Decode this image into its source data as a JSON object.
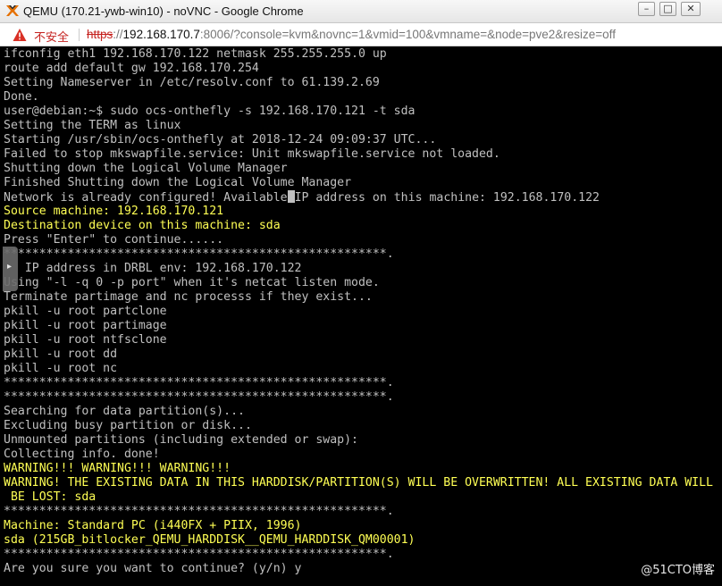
{
  "window": {
    "title": "QEMU (170.21-ywb-win10) - noVNC - Google Chrome",
    "controls": {
      "minimize": "–",
      "maximize": "□",
      "close": "✕"
    }
  },
  "address": {
    "security_label": "不安全",
    "url_protocol": "https",
    "url_sep": "://",
    "url_host": "192.168.170.7",
    "url_rest": ":8006/?console=kvm&novnc=1&vmid=100&vmname=&node=pve2&resize=off"
  },
  "terminal": {
    "lines": [
      {
        "text": "ifconfig eth1 192.168.170.122 netmask 255.255.255.0 up",
        "color": "grey"
      },
      {
        "text": "route add default gw 192.168.170.254",
        "color": "grey"
      },
      {
        "text": "Setting Nameserver in /etc/resolv.conf to 61.139.2.69",
        "color": "grey"
      },
      {
        "text": "Done.",
        "color": "grey"
      },
      {
        "text": "user@debian:~$ sudo ocs-onthefly -s 192.168.170.121 -t sda",
        "color": "grey"
      },
      {
        "text": "Setting the TERM as linux",
        "color": "grey"
      },
      {
        "text": "Starting /usr/sbin/ocs-onthefly at 2018-12-24 09:09:37 UTC...",
        "color": "grey"
      },
      {
        "text": "Failed to stop mkswapfile.service: Unit mkswapfile.service not loaded.",
        "color": "grey"
      },
      {
        "text": "Shutting down the Logical Volume Manager",
        "color": "grey"
      },
      {
        "text": "Finished Shutting down the Logical Volume Manager",
        "color": "grey"
      },
      {
        "text": "Network is already configured! Available IP address on this machine: 192.168.170.122",
        "color": "grey"
      },
      {
        "text": "Source machine: 192.168.170.121",
        "color": "yellow"
      },
      {
        "text": "Destination device on this machine: sda",
        "color": "yellow"
      },
      {
        "text": "Press \"Enter\" to continue......",
        "color": "grey"
      },
      {
        "text": "******************************************************.",
        "color": "grey"
      },
      {
        "text": "   IP address in DRBL env: 192.168.170.122",
        "color": "grey"
      },
      {
        "text": "Using \"-l -q 0 -p port\" when it's netcat listen mode.",
        "color": "grey"
      },
      {
        "text": "Terminate partimage and nc processs if they exist...",
        "color": "grey"
      },
      {
        "text": "pkill -u root partclone",
        "color": "grey"
      },
      {
        "text": "pkill -u root partimage",
        "color": "grey"
      },
      {
        "text": "pkill -u root ntfsclone",
        "color": "grey"
      },
      {
        "text": "pkill -u root dd",
        "color": "grey"
      },
      {
        "text": "pkill -u root nc",
        "color": "grey"
      },
      {
        "text": "******************************************************.",
        "color": "grey"
      },
      {
        "text": "******************************************************.",
        "color": "grey"
      },
      {
        "text": "Searching for data partition(s)...",
        "color": "grey"
      },
      {
        "text": "Excluding busy partition or disk...",
        "color": "grey"
      },
      {
        "text": "Unmounted partitions (including extended or swap):",
        "color": "grey"
      },
      {
        "text": "Collecting info. done!",
        "color": "grey"
      },
      {
        "text": "WARNING!!! WARNING!!! WARNING!!!",
        "color": "yellow"
      },
      {
        "text": "WARNING! THE EXISTING DATA IN THIS HARDDISK/PARTITION(S) WILL BE OVERWRITTEN! ALL EXISTING DATA WILL",
        "color": "yellow"
      },
      {
        "text": " BE LOST: sda",
        "color": "yellow"
      },
      {
        "text": "******************************************************.",
        "color": "grey"
      },
      {
        "text": "Machine: Standard PC (i440FX + PIIX, 1996)",
        "color": "yellow"
      },
      {
        "text": "sda (215GB_bitlocker_QEMU_HARDDISK__QEMU_HARDDISK_QM00001)",
        "color": "yellow"
      },
      {
        "text": "******************************************************.",
        "color": "grey"
      },
      {
        "text": "Are you sure you want to continue? (y/n) y",
        "color": "grey"
      }
    ],
    "cursor_line": 10,
    "cursor_after": "Network is already configured! Available",
    "cursor_rest": "IP address on this machine: 192.168.170.122",
    "colors": {
      "grey": "#c0c0c0",
      "yellow": "#ffff54",
      "background": "#000000"
    }
  },
  "novnc": {
    "sidebar_handle_icon": "chevron-right-icon",
    "handle_glyph": "▸"
  },
  "watermark": {
    "text": "@51CTO博客"
  }
}
